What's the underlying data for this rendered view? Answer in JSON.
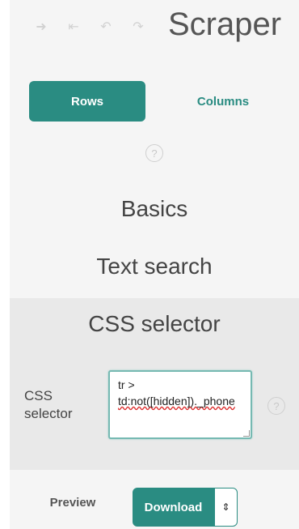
{
  "toolbar": {
    "icons": [
      "arrow-right-icon",
      "skip-back-icon",
      "undo-icon",
      "redo-icon"
    ],
    "icon_glyphs": [
      "➜",
      "⇤",
      "↶",
      "↷"
    ],
    "title": "Scraper"
  },
  "tabs": [
    {
      "label": "Rows",
      "active": true
    },
    {
      "label": "Columns",
      "active": false
    }
  ],
  "help_glyph": "?",
  "sections": {
    "basics": "Basics",
    "text_search": "Text search",
    "css_selector": "CSS selector"
  },
  "css_selector_field": {
    "label": "CSS selector",
    "value_line1": "tr >",
    "value_line2": "td:not([hidden])._phone"
  },
  "footer": {
    "preview_label": "Preview",
    "download_label": "Download",
    "toggle_glyph": "⇕"
  },
  "colors": {
    "accent": "#2a8c82",
    "panel_bg": "#f5f5f5",
    "selected_section_bg": "#e9e9e9"
  }
}
